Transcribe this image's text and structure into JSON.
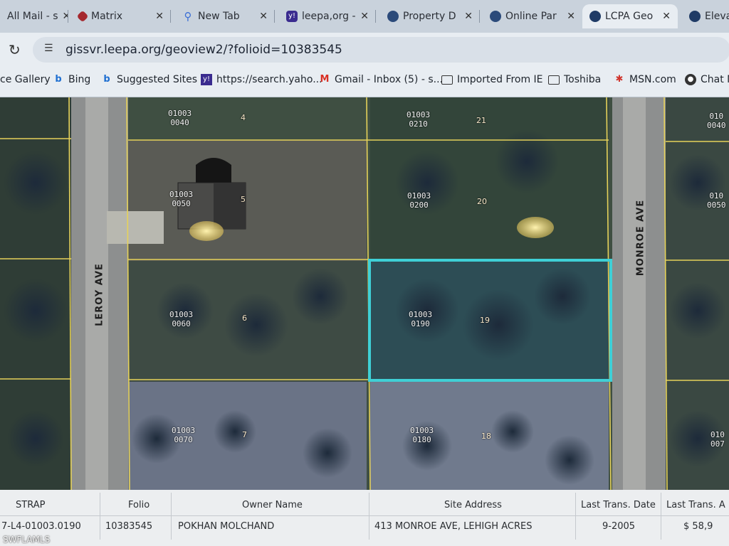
{
  "tabs": [
    {
      "label": "All Mail - s",
      "icon": "mail-icon",
      "icon_color": "#6b6b6b"
    },
    {
      "label": "Matrix",
      "icon": "matrix-icon",
      "icon_color": "#a5282e"
    },
    {
      "label": "New Tab",
      "icon": "location-icon",
      "icon_color": "#3b6fd6"
    },
    {
      "label": "leepa,org -",
      "icon": "yahoo-icon",
      "icon_color": "#3a2b8f"
    },
    {
      "label": "Property D",
      "icon": "globe-icon",
      "icon_color": "#2b4a7a"
    },
    {
      "label": "Online Par",
      "icon": "globe-icon",
      "icon_color": "#2b4a7a"
    },
    {
      "label": "LCPA Geo",
      "icon": "globe-icon",
      "icon_color": "#1f3b66"
    },
    {
      "label": "Elevat",
      "icon": "chrome-icon",
      "icon_color": "#1f3b66"
    }
  ],
  "address": {
    "url": "gissvr.leepa.org/geoview2/?folioid=10383545"
  },
  "bookmarks": [
    {
      "label": "ce Gallery",
      "icon": ""
    },
    {
      "label": "Bing",
      "icon": "bing-icon"
    },
    {
      "label": "Suggested Sites",
      "icon": "bing-icon"
    },
    {
      "label": "https://search.yaho...",
      "icon": "yahoo-icon"
    },
    {
      "label": "Gmail - Inbox (5) - s...",
      "icon": "gmail-icon"
    },
    {
      "label": "Imported From IE",
      "icon": "folder-icon"
    },
    {
      "label": "Toshiba",
      "icon": "folder-icon"
    },
    {
      "label": "MSN.com",
      "icon": "msn-icon"
    },
    {
      "label": "Chat N",
      "icon": "chat-icon"
    }
  ],
  "map": {
    "roads": [
      "LEROY AVE",
      "MONROE AVE"
    ],
    "parcels": [
      {
        "code1": "01003",
        "code2": "0040",
        "lot": "4"
      },
      {
        "code1": "01003",
        "code2": "0210",
        "lot": "21"
      },
      {
        "code1": "01003",
        "code2": "0050",
        "lot": "5"
      },
      {
        "code1": "01003",
        "code2": "0200",
        "lot": "20"
      },
      {
        "code1": "01003",
        "code2": "0060",
        "lot": "6"
      },
      {
        "code1": "01003",
        "code2": "0190",
        "lot": "19"
      },
      {
        "code1": "01003",
        "code2": "0070",
        "lot": "7"
      },
      {
        "code1": "01003",
        "code2": "0180",
        "lot": "18"
      }
    ],
    "edge_labels": [
      "010",
      "0040",
      "010",
      "0050",
      "010",
      "007"
    ],
    "selected_color": "#3fd0d6",
    "line_color": "#e6d25a"
  },
  "table": {
    "headers": [
      "STRAP",
      "Folio",
      "Owner Name",
      "Site Address",
      "Last Trans. Date",
      "Last Trans. A"
    ],
    "row": [
      "7-L4-01003.0190",
      "10383545",
      "POKHAN MOLCHAND",
      "413 MONROE AVE, LEHIGH ACRES",
      "9-2005",
      "$ 58,9"
    ]
  },
  "watermark": "SWFLAMLS"
}
